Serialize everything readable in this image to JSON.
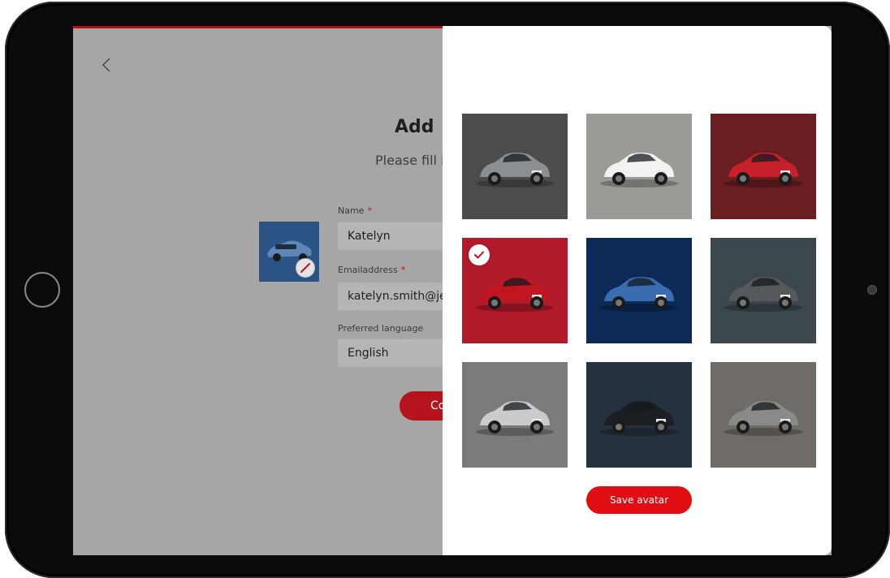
{
  "form": {
    "title": "Add",
    "subtitle": "Please fill i",
    "name_label": "Name",
    "name_value": "Katelyn",
    "email_label": "Emailaddress",
    "email_value": "katelyn.smith@jemo",
    "language_label": "Preferred language",
    "language_value": "English",
    "required_mark": "*",
    "continue_label": "Co"
  },
  "avatar_picker": {
    "save_label": "Save avatar",
    "selected_index": 3,
    "avatars": [
      {
        "name": "hatchback-gray",
        "bg": "#4b4c4b",
        "car": "#8c8f92"
      },
      {
        "name": "suv-white",
        "bg": "#9a9a96",
        "car": "#f2f2f0"
      },
      {
        "name": "hatchback-red",
        "bg": "#6a1e22",
        "car": "#c8202a"
      },
      {
        "name": "suv-red",
        "bg": "#b01a2a",
        "car": "#c1161f"
      },
      {
        "name": "crossover-blue",
        "bg": "#0d2a57",
        "car": "#3a6db0"
      },
      {
        "name": "sportscar-gray",
        "bg": "#3b474c",
        "car": "#56595b"
      },
      {
        "name": "supra-silver",
        "bg": "#7a7b7a",
        "car": "#c9cbcc"
      },
      {
        "name": "landcruiser-black",
        "bg": "#25323d",
        "car": "#1b1f22"
      },
      {
        "name": "pickup-gray",
        "bg": "#6f6c67",
        "car": "#8a8a88"
      }
    ]
  },
  "colors": {
    "accent_red": "#e00d12",
    "dim_overlay": "#a6a6a6"
  },
  "icons": {
    "back": "chevron-left-icon",
    "edit": "pencil-icon",
    "check": "checkmark-icon"
  }
}
